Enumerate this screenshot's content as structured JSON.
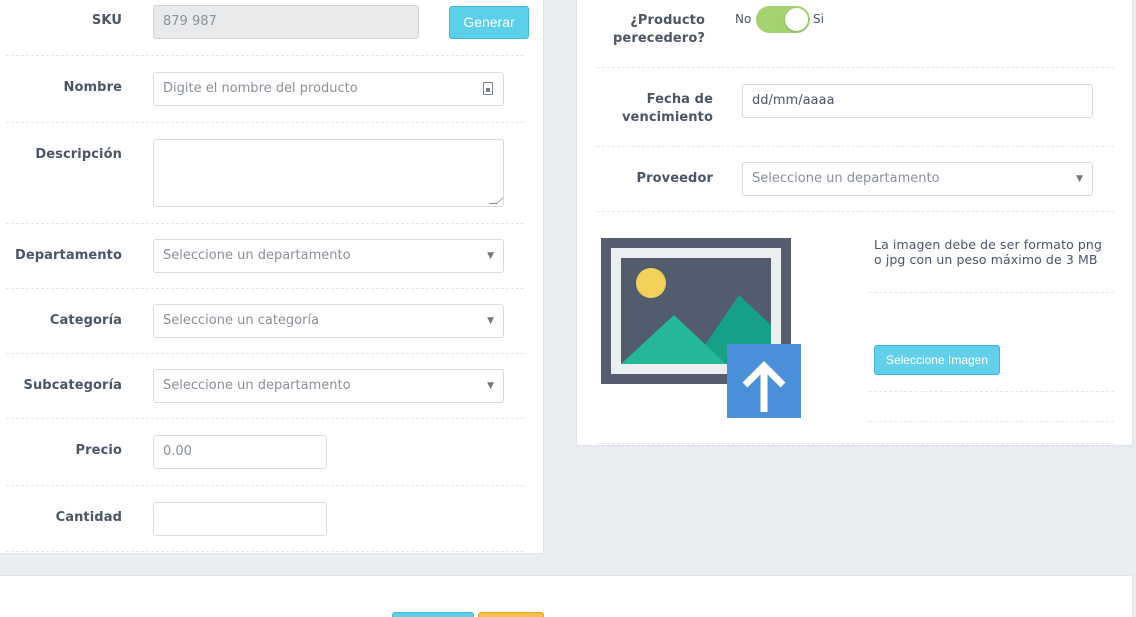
{
  "form_left": {
    "sku": {
      "label": "SKU",
      "value": "879 987",
      "generate_label": "Generar"
    },
    "nombre": {
      "label": "Nombre",
      "placeholder": "Digite el nombre del producto"
    },
    "descripcion": {
      "label": "Descripción",
      "value": ""
    },
    "departamento": {
      "label": "Departamento",
      "selected": "Seleccione un departamento"
    },
    "categoria": {
      "label": "Categoría",
      "selected": "Seleccione un categoría"
    },
    "subcategoria": {
      "label": "Subcategoría",
      "selected": "Seleccione un departamento"
    },
    "precio": {
      "label": "Precio",
      "placeholder": "0.00"
    },
    "cantidad": {
      "label": "Cantidad",
      "value": ""
    }
  },
  "form_right": {
    "perecedero": {
      "label_line1": "¿Producto",
      "label_line2": "perecedero?",
      "off_label": "No",
      "on_label": "Si",
      "checked": true
    },
    "fecha": {
      "label_line1": "Fecha de",
      "label_line2": "vencimiento",
      "value": "dd/mm/aaaa"
    },
    "proveedor": {
      "label": "Proveedor",
      "selected": "Seleccione un departamento"
    },
    "imagen": {
      "hint": "La imagen debe de ser formato png o jpg con un peso máximo de 3 MB",
      "button_label": "Seleccione Imagen",
      "icon": "image-upload-icon"
    }
  },
  "colors": {
    "toggle_on": "#a6d16f",
    "info_button": "#5ccfe9",
    "warning_button": "#f7bf47",
    "upload_blue": "#4a90d9",
    "frame_dark": "#555d6e",
    "mountain_green": "#24b897",
    "mountain_dark_green": "#16a085",
    "sun_yellow": "#f1d15a"
  }
}
